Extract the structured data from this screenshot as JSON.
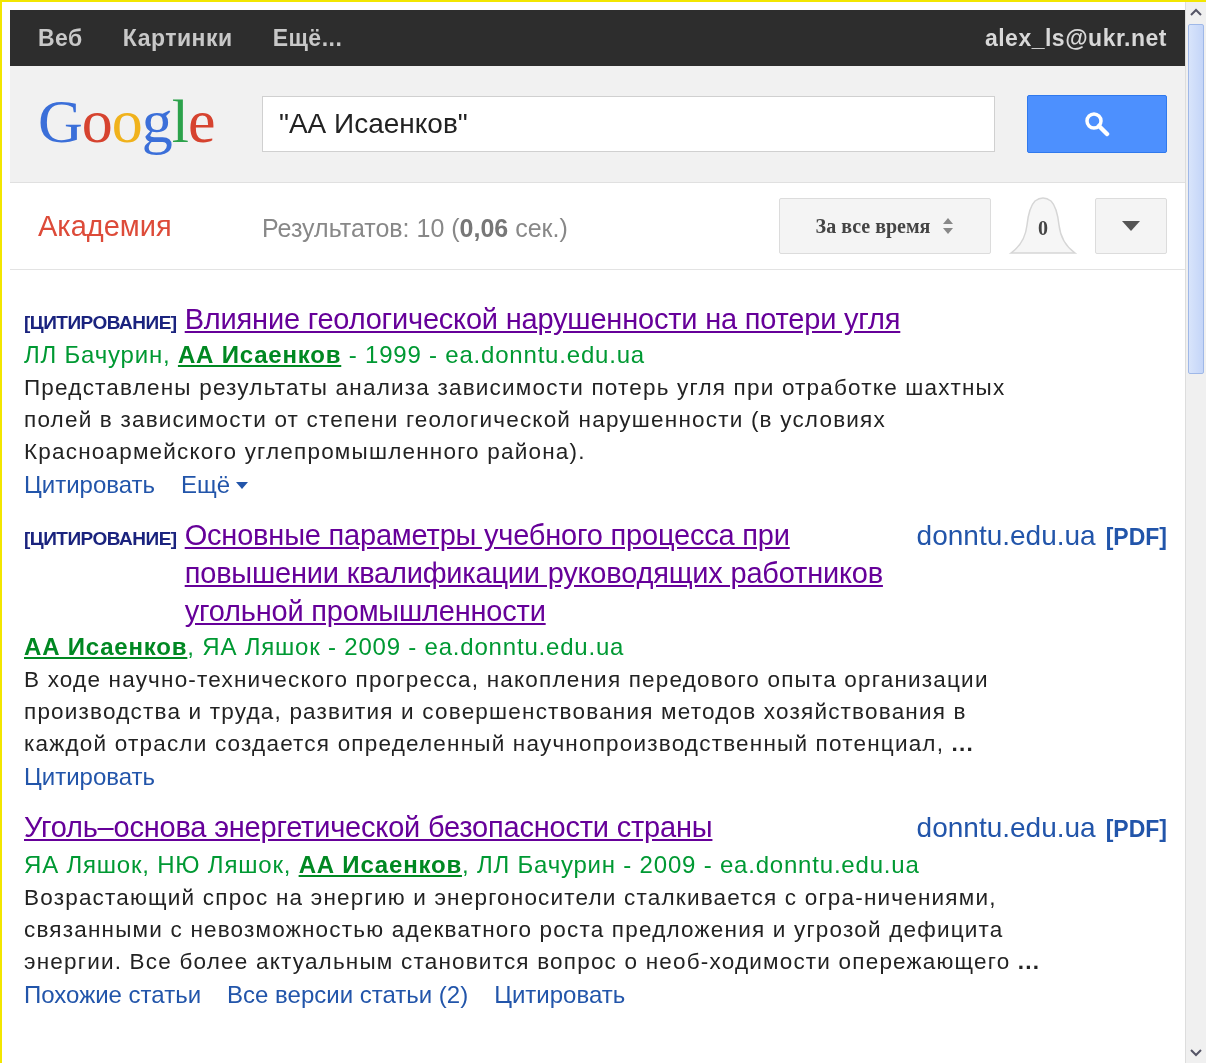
{
  "top_bar": {
    "links": [
      {
        "label": "Веб"
      },
      {
        "label": "Картинки"
      },
      {
        "label": "Ещё..."
      }
    ],
    "account": "alex_ls@ukr.net"
  },
  "header": {
    "logo": "Google",
    "search": {
      "value": "\"АА Исаенков\""
    }
  },
  "toolbar": {
    "section": "Академия",
    "stats": "Результатов: 10 (**0,06** сек.)",
    "date_filter": "За все время",
    "alerts_count": "0"
  },
  "results": [
    {
      "tag": "[ЦИТИРОВАНИЕ]",
      "title": "Влияние геологической нарушенности на потери угля",
      "authors": "ЛЛ Бачурин, **АА Исаенков** - 1999 - ea.donntu.edu.ua",
      "snippet": "Представлены результаты анализа зависимости потерь угля при отработке шахтных полей в зависимости от степени геологической нарушенности (в условиях Красноармейского углепромышленного района).",
      "actions": [
        {
          "label": "Цитировать",
          "kind": "link"
        },
        {
          "label": "Ещё",
          "kind": "menu"
        }
      ]
    },
    {
      "tag": "[ЦИТИРОВАНИЕ]",
      "title": "Основные параметры учебного процесса при повышении квалификации руководящих работников угольной промышленности",
      "side": {
        "domain": "donntu.edu.ua",
        "format": "[PDF]"
      },
      "authors": "**АА Исаенков**, ЯА Ляшок - 2009 - ea.donntu.edu.ua",
      "snippet": "В ходе научно-технического прогресса, накопления передового опыта организации производства и труда, развития и совершенствования методов хозяйствования в каждой отрасли создается определенный научнопроизводственный потенциал, **...**",
      "actions": [
        {
          "label": "Цитировать",
          "kind": "link"
        }
      ]
    },
    {
      "title": "Уголь–основа энергетической безопасности страны",
      "side": {
        "domain": "donntu.edu.ua",
        "format": "[PDF]"
      },
      "authors": "ЯА Ляшок, НЮ Ляшок, **АА Исаенков**, ЛЛ Бачурин - 2009 - ea.donntu.edu.ua",
      "snippet": "Возрастающий спрос на энергию и энергоносители сталкивается с огра-ничениями, связанными с невозможностью адекватного роста предложения и угрозой дефицита энергии. Все более актуальным становится вопрос о необ-ходимости опережающего **...**",
      "actions": [
        {
          "label": "Похожие статьи",
          "kind": "link"
        },
        {
          "label": "Все версии статьи (2)",
          "kind": "link"
        },
        {
          "label": "Цитировать",
          "kind": "link"
        }
      ]
    }
  ]
}
